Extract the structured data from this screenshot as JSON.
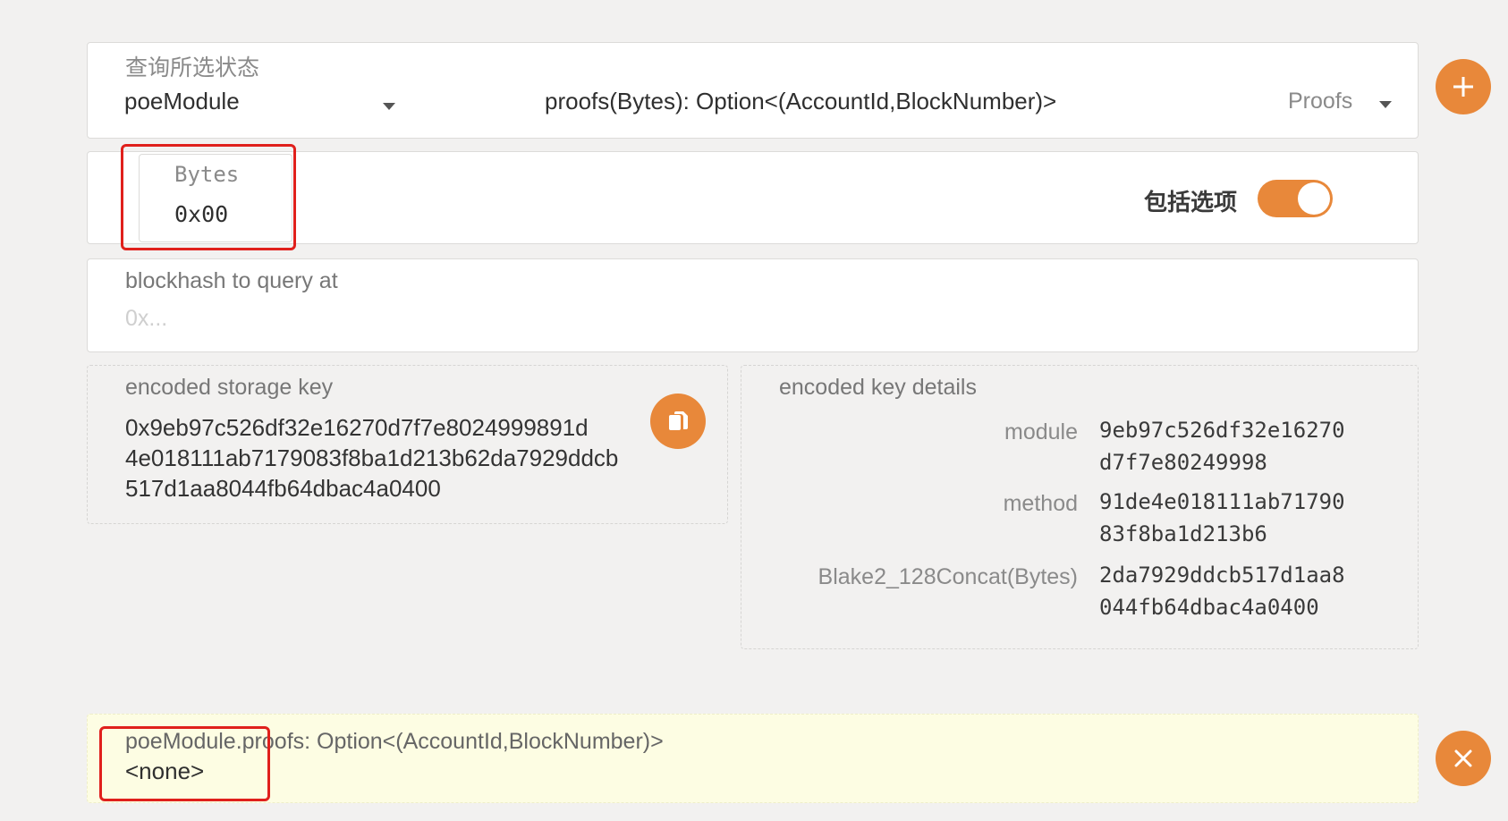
{
  "query": {
    "section_label": "查询所选状态",
    "module": "poeModule",
    "method": "proofs(Bytes): Option<(AccountId,BlockNumber)>",
    "method_hint": "Proofs"
  },
  "param": {
    "label": "Bytes",
    "value": "0x00",
    "toggle_label": "包括选项",
    "toggle_on": true
  },
  "blockhash": {
    "label": "blockhash to query at",
    "placeholder": "0x..."
  },
  "storage_key": {
    "label": "encoded storage key",
    "lines": [
      "0x9eb97c526df32e16270d7f7e8024999891d",
      "4e018111ab7179083f8ba1d213b62da7929ddcb",
      "517d1aa8044fb64dbac4a0400"
    ]
  },
  "key_details": {
    "label": "encoded key details",
    "rows": [
      {
        "name": "module",
        "lines": [
          "9eb97c526df32e16270",
          "d7f7e80249998"
        ]
      },
      {
        "name": "method",
        "lines": [
          "91de4e018111ab71790",
          "83f8ba1d213b6"
        ]
      },
      {
        "name": "Blake2_128Concat(Bytes)",
        "lines": [
          "2da7929ddcb517d1aa8",
          "044fb64dbac4a0400"
        ]
      }
    ]
  },
  "result": {
    "title": "poeModule.proofs: Option<(AccountId,BlockNumber)>",
    "value": "<none>"
  },
  "icons": {
    "add": "plus-icon",
    "copy": "copy-icon",
    "close": "close-icon",
    "dropdown": "chevron-down-icon"
  },
  "colors": {
    "accent": "#e8883a",
    "result_bg": "#fdfde3",
    "highlight": "#e0201c"
  }
}
